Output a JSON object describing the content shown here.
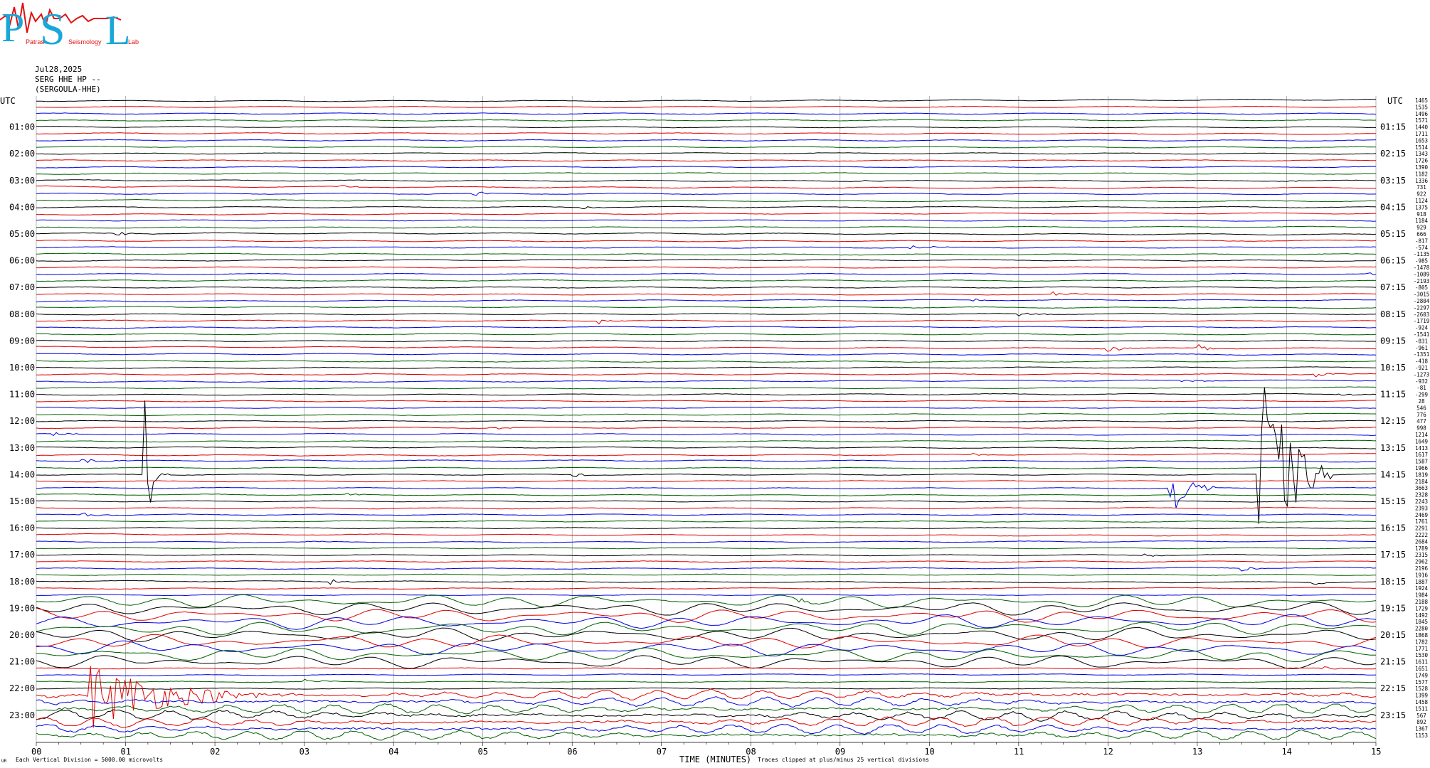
{
  "logo": {
    "letters": "PSL",
    "text_lines": [
      "Patras",
      "Seismology",
      "Lab"
    ]
  },
  "header": {
    "date": "Jul28,2025",
    "channel": "SERG HHE HP --",
    "station": "(SERGOULA-HHE)"
  },
  "colors": {
    "trace_cycle": [
      "#000000",
      "#e00000",
      "#0000e0",
      "#006000"
    ],
    "grid": "#888888",
    "logo_cyan": "#19a7d9",
    "logo_red": "#e01010"
  },
  "footer": {
    "corner_mark": "UR",
    "division_note": "Each Vertical Division = 5000.00 microvolts",
    "axis_title": "TIME (MINUTES)",
    "clip_note": "Traces clipped at plus/minus 25 vertical divisions"
  },
  "chart_data": {
    "type": "line",
    "title": "",
    "xlabel": "TIME (MINUTES)",
    "ylabel": "UTC",
    "xlim": [
      0,
      15
    ],
    "x_ticks": [
      "00",
      "01",
      "02",
      "03",
      "04",
      "05",
      "06",
      "07",
      "08",
      "09",
      "10",
      "11",
      "12",
      "13",
      "14",
      "15"
    ],
    "y_axis_label_left": "UTC",
    "y_axis_label_right": "UTC",
    "left_hour_labels": [
      "01:00",
      "02:00",
      "03:00",
      "04:00",
      "05:00",
      "06:00",
      "07:00",
      "08:00",
      "09:00",
      "10:00",
      "11:00",
      "12:00",
      "13:00",
      "14:00",
      "15:00",
      "16:00",
      "17:00",
      "18:00",
      "19:00",
      "20:00",
      "21:00",
      "22:00",
      "23:00"
    ],
    "right_hour_labels": [
      "01:15",
      "02:15",
      "03:15",
      "04:15",
      "05:15",
      "06:15",
      "07:15",
      "08:15",
      "09:15",
      "10:15",
      "11:15",
      "12:15",
      "13:15",
      "14:15",
      "15:15",
      "16:15",
      "17:15",
      "18:15",
      "19:15",
      "20:15",
      "21:15",
      "22:15",
      "23:15"
    ],
    "traces_per_hour": 4,
    "minutes_per_trace": 15,
    "trace_scale_values": [
      "1465",
      "1535",
      "1496",
      "1571",
      "1440",
      "1711",
      "1653",
      "1514",
      "1343",
      "1726",
      "1390",
      "1182",
      "1336",
      "731",
      "922",
      "1124",
      "1375",
      "918",
      "1184",
      "929",
      "666",
      "-817",
      "-574",
      "-1135",
      "-985",
      "-1478",
      "-1089",
      "-2193",
      "-805",
      "-3015",
      "-2804",
      "-2297",
      "-2603",
      "-1719",
      "-924",
      "-1541",
      "-831",
      "-961",
      "-1351",
      "-418",
      "-921",
      "-1273",
      "-932",
      "-81",
      "-299",
      "28",
      "546",
      "776",
      "477",
      "998",
      "1214",
      "1649",
      "1413",
      "1617",
      "1587",
      "1966",
      "1819",
      "2184",
      "3663",
      "2328",
      "2243",
      "2393",
      "2469",
      "1761",
      "2291",
      "2222",
      "2684",
      "1789",
      "2315",
      "2962",
      "2196",
      "1916",
      "1887",
      "1924",
      "1984",
      "2188",
      "1729",
      "1492",
      "1845",
      "2280",
      "1868",
      "1782",
      "1771",
      "1530",
      "1611",
      "1651",
      "1749",
      "1577",
      "1528",
      "1399",
      "1458",
      "1511",
      "567",
      "892",
      "1367",
      "1153"
    ],
    "events": [
      {
        "trace": 13,
        "minute": 3.4,
        "amp": 3,
        "len": 0.35
      },
      {
        "trace": 14,
        "minute": 4.9,
        "amp": 5,
        "len": 0.25
      },
      {
        "trace": 16,
        "minute": 6.1,
        "amp": 3,
        "len": 0.25
      },
      {
        "trace": 12,
        "minute": 9.2,
        "amp": 3,
        "len": 0.3
      },
      {
        "trace": 12,
        "minute": 14.0,
        "amp": 3,
        "len": 0.3
      },
      {
        "trace": 20,
        "minute": 0.9,
        "amp": 3,
        "len": 0.5
      },
      {
        "trace": 22,
        "minute": 9.8,
        "amp": 4,
        "len": 0.5
      },
      {
        "trace": 26,
        "minute": 14.9,
        "amp": 4,
        "len": 0.3
      },
      {
        "trace": 30,
        "minute": 10.5,
        "amp": 3,
        "len": 0.2
      },
      {
        "trace": 29,
        "minute": 11.4,
        "amp": 3,
        "len": 0.4
      },
      {
        "trace": 32,
        "minute": 11.0,
        "amp": 3,
        "len": 0.4
      },
      {
        "trace": 33,
        "minute": 6.3,
        "amp": 4,
        "len": 0.3
      },
      {
        "trace": 37,
        "minute": 12.0,
        "amp": 4,
        "len": 0.5
      },
      {
        "trace": 37,
        "minute": 13.0,
        "amp": 6,
        "len": 0.4
      },
      {
        "trace": 41,
        "minute": 14.3,
        "amp": 4,
        "len": 0.5
      },
      {
        "trace": 42,
        "minute": 12.8,
        "amp": 3,
        "len": 0.5
      },
      {
        "trace": 44,
        "minute": 14.6,
        "amp": 3,
        "len": 0.4
      },
      {
        "trace": 49,
        "minute": 5.1,
        "amp": 3,
        "len": 0.3
      },
      {
        "trace": 50,
        "minute": 0.2,
        "amp": 3,
        "len": 0.4
      },
      {
        "trace": 53,
        "minute": 10.5,
        "amp": 3,
        "len": 0.4
      },
      {
        "trace": 54,
        "minute": 0.5,
        "amp": 4,
        "len": 0.6
      },
      {
        "trace": 56,
        "minute": 6.0,
        "amp": 4,
        "len": 0.3
      },
      {
        "trace": 56,
        "minute": 1.2,
        "amp": 120,
        "len": 0.3
      },
      {
        "trace": 56,
        "minute": 13.7,
        "amp": 170,
        "len": 0.8
      },
      {
        "trace": 58,
        "minute": 12.7,
        "amp": 40,
        "len": 0.5
      },
      {
        "trace": 59,
        "minute": 3.5,
        "amp": 3,
        "len": 0.4
      },
      {
        "trace": 62,
        "minute": 0.5,
        "amp": 4,
        "len": 0.4
      },
      {
        "trace": 66,
        "minute": 3.0,
        "amp": 3,
        "len": 0.3
      },
      {
        "trace": 67,
        "minute": 5.4,
        "amp": 3,
        "len": 0.3
      },
      {
        "trace": 68,
        "minute": 12.4,
        "amp": 3,
        "len": 0.3
      },
      {
        "trace": 70,
        "minute": 13.5,
        "amp": 4,
        "len": 0.3
      },
      {
        "trace": 72,
        "minute": 3.3,
        "amp": 4,
        "len": 0.3
      },
      {
        "trace": 72,
        "minute": 14.3,
        "amp": 4,
        "len": 0.3
      },
      {
        "trace": 75,
        "minute": 8.5,
        "amp": 5,
        "len": 0.5
      },
      {
        "trace": 85,
        "minute": 14.4,
        "amp": 3,
        "len": 0.4
      },
      {
        "trace": 87,
        "minute": 3.0,
        "amp": 4,
        "len": 0.4
      },
      {
        "trace": 89,
        "minute": 0.6,
        "amp": 50,
        "len": 2.2
      }
    ],
    "noisy_trace_range": [
      75,
      84
    ],
    "coda_trace_range": [
      89,
      95
    ]
  }
}
